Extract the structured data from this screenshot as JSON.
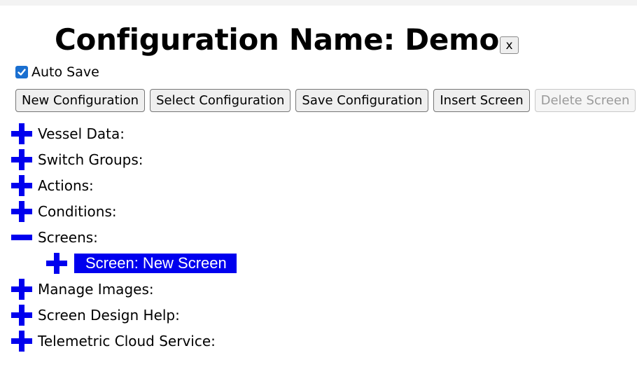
{
  "header": {
    "title": "Configuration Name: Demo",
    "close_label": "x"
  },
  "autosave": {
    "label": "Auto Save",
    "checked": true
  },
  "toolbar": {
    "buttons": [
      {
        "label": "New Configuration",
        "enabled": true
      },
      {
        "label": "Select Configuration",
        "enabled": true
      },
      {
        "label": "Save Configuration",
        "enabled": true
      },
      {
        "label": "Insert Screen",
        "enabled": true
      },
      {
        "label": "Delete Screen",
        "enabled": false
      }
    ]
  },
  "tree": {
    "items": [
      {
        "label": "Vessel Data:",
        "icon": "plus-icon"
      },
      {
        "label": "Switch Groups:",
        "icon": "plus-icon"
      },
      {
        "label": "Actions:",
        "icon": "plus-icon"
      },
      {
        "label": "Conditions:",
        "icon": "plus-icon"
      },
      {
        "label": "Screens:",
        "icon": "minus-icon",
        "children": [
          {
            "label": "Screen: New Screen",
            "icon": "plus-icon",
            "selected": true
          }
        ]
      },
      {
        "label": "Manage Images:",
        "icon": "plus-icon"
      },
      {
        "label": "Screen Design Help:",
        "icon": "plus-icon"
      },
      {
        "label": "Telemetric Cloud Service:",
        "icon": "plus-icon"
      }
    ]
  },
  "colors": {
    "icon_blue": "#0000ee",
    "selected_bg": "#0000ee",
    "checkbox_blue": "#1a6fd0"
  }
}
